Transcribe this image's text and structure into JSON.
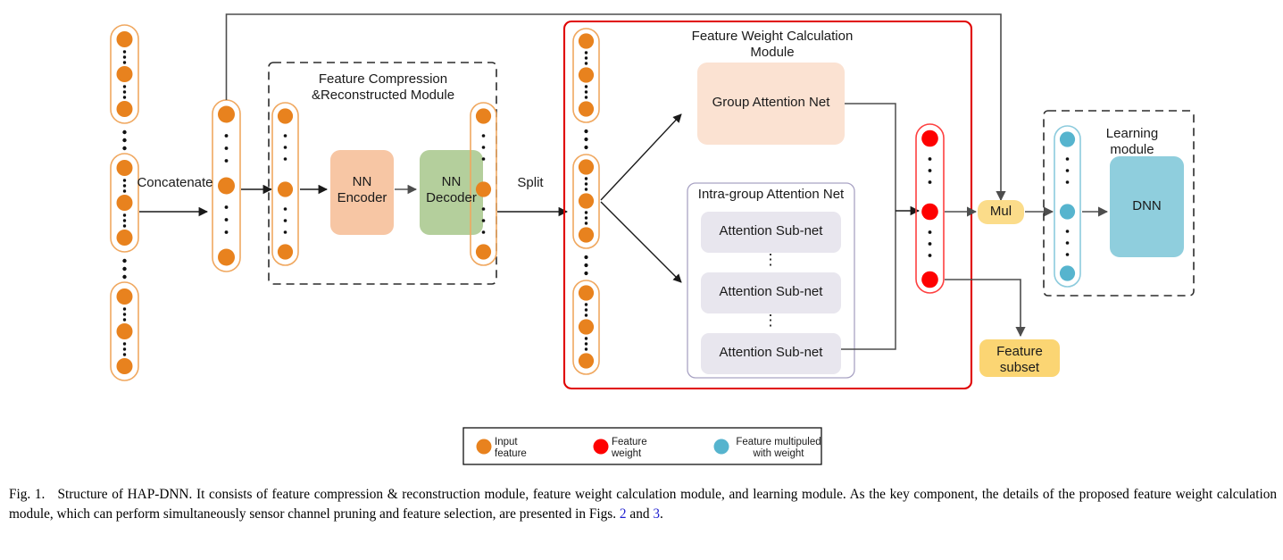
{
  "figure": {
    "label": "Fig. 1.",
    "caption_part1": "Structure of HAP-DNN. It consists of feature compression & reconstruction module, feature weight calculation module, and learning module. As the key component, the details of the proposed feature weight calculation module, which can perform simultaneously sensor channel pruning and feature selection, are presented in Figs. ",
    "ref1": "2",
    "caption_mid": " and ",
    "ref2": "3",
    "caption_end": "."
  },
  "edges": {
    "concatenate": "Concatenate",
    "split": "Split"
  },
  "modules": {
    "compression": {
      "title": "Feature Compression\n&Reconstructed Module",
      "encoder": "NN\nEncoder",
      "decoder": "NN\nDecoder"
    },
    "weight_calculation": {
      "title": "Feature Weight Calculation\nModule",
      "group_attention": "Group Attention Net",
      "intra_group_title": "Intra-group Attention Net",
      "subnets": [
        "Attention Sub-net",
        "Attention Sub-net",
        "Attention Sub-net"
      ],
      "vdots": "⋮"
    },
    "learning": {
      "title": "Learning\nmodule",
      "dnn": "DNN"
    }
  },
  "nodes": {
    "mul": "Mul",
    "feature_subset": "Feature\nsubset"
  },
  "legend": [
    {
      "color": "#E8821E",
      "label": "Input\nfeature"
    },
    {
      "color": "#FE0000",
      "label": "Feature\nweight"
    },
    {
      "color": "#56B4CE",
      "label": "Feature multipuled\nwith weight"
    }
  ],
  "colors": {
    "input_feature": "#E8821E",
    "feature_weight": "#FE0000",
    "weighted_feature": "#56B4CE",
    "encoder_fill": "#F7C6A4",
    "decoder_fill": "#B4CF9C",
    "group_attention_fill": "#FBE2D2",
    "intra_group_fill": "#FFFFFF",
    "subnet_fill": "#E8E6EE",
    "dnn_fill": "#8FCEDD",
    "mul_fill": "#FBDC8A",
    "feature_subset_fill": "#FBD573",
    "weight_module_border": "#E00000",
    "dashed_border": "#2b2b2b",
    "arrow": "#4d4d4d",
    "reference_link": "#2020d0"
  }
}
